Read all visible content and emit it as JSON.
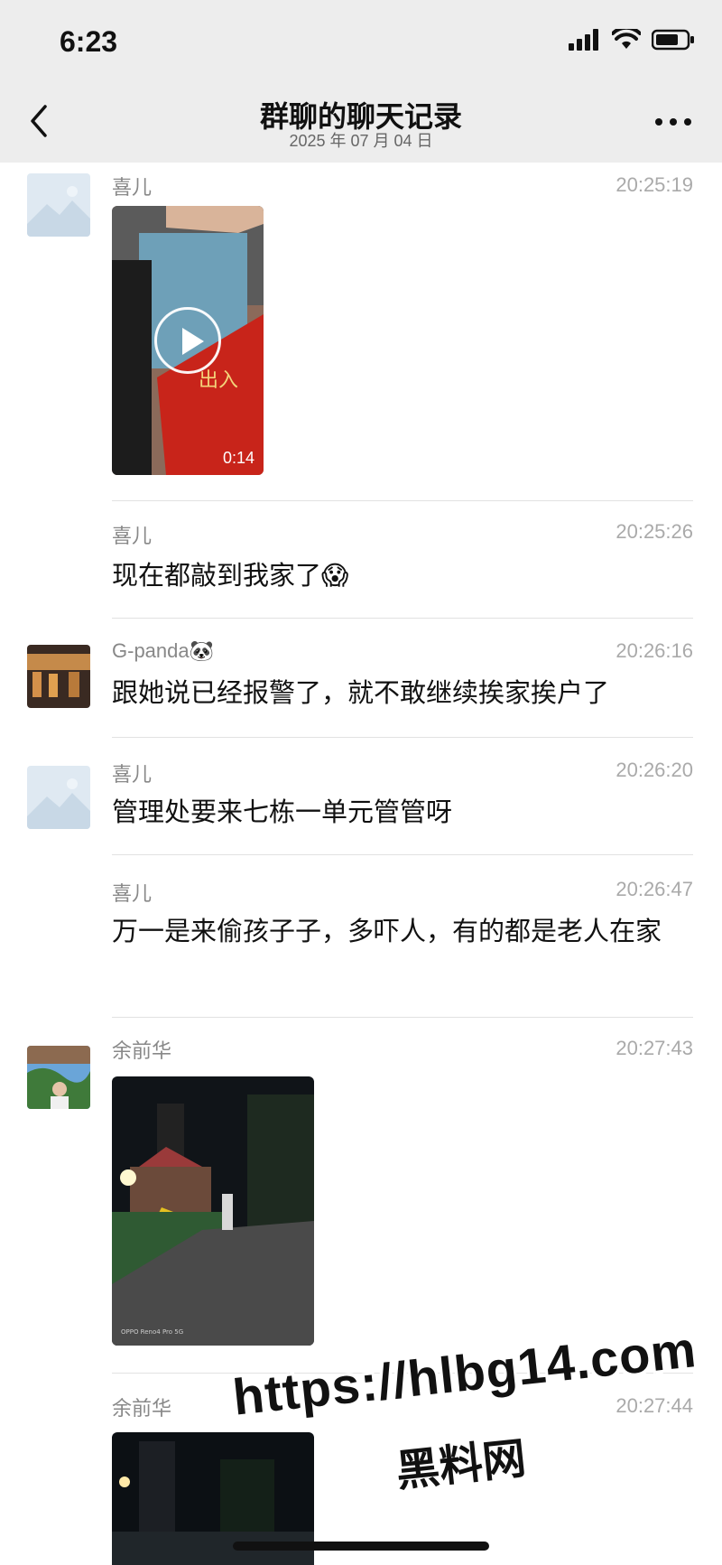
{
  "status": {
    "time": "6:23"
  },
  "nav": {
    "title": "群聊的聊天记录",
    "subtitle": "2025 年 07 月 04 日"
  },
  "messages": [
    {
      "sender": "喜儿",
      "time": "20:25:19",
      "video_duration": "0:14",
      "image_overlay": "出入"
    },
    {
      "sender": "喜儿",
      "time": "20:25:26",
      "text": "现在都敲到我家了😱"
    },
    {
      "sender": "G-panda🐼",
      "time": "20:26:16",
      "text": "跟她说已经报警了，就不敢继续挨家挨户了"
    },
    {
      "sender": "喜儿",
      "time": "20:26:20",
      "text": "管理处要来七栋一单元管管呀"
    },
    {
      "sender": "喜儿",
      "time": "20:26:47",
      "text": "万一是来偷孩子子，多吓人，有的都是老人在家"
    },
    {
      "sender": "余前华",
      "time": "20:27:43",
      "image_caption": "OPPO Reno4 Pro 5G"
    },
    {
      "sender": "余前华",
      "time": "20:27:44"
    }
  ],
  "watermark": {
    "url": "https://hlbg14.com",
    "name": "黑料网"
  }
}
